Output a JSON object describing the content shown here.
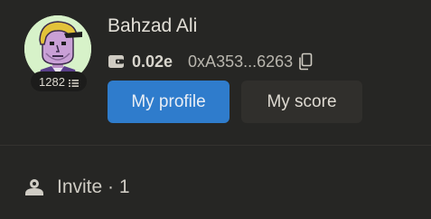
{
  "profile": {
    "name": "Bahzad Ali",
    "level": "1282",
    "balance": "0.02e",
    "address": "0xA353...6263",
    "avatar_bg": "#d7f2c9"
  },
  "actions": {
    "my_profile_label": "My profile",
    "my_score_label": "My score",
    "primary_color": "#2f7ccc"
  },
  "invite": {
    "label": "Invite · 1"
  },
  "icons": {
    "level": "level-bars-icon",
    "wallet": "wallet-icon",
    "copy": "copy-icon",
    "invite": "user-plus-icon"
  }
}
